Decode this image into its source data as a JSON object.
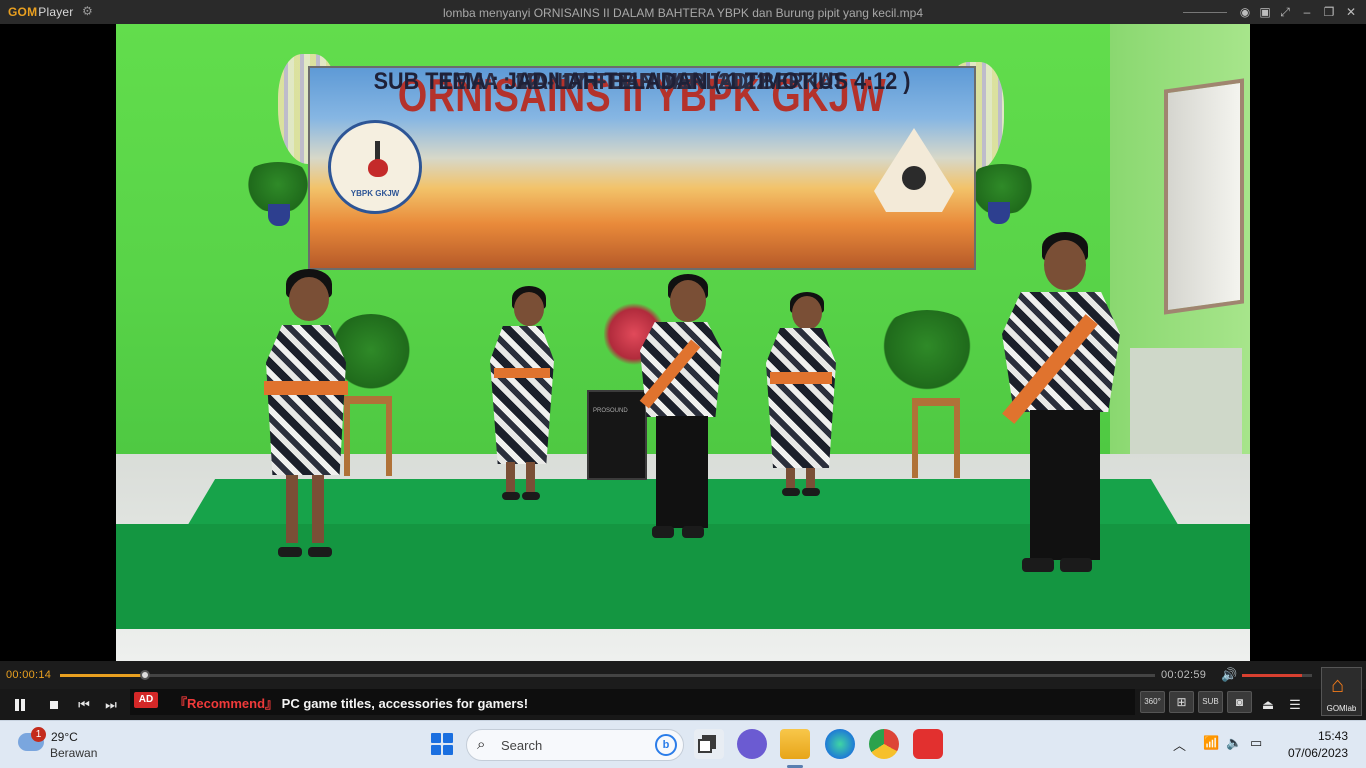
{
  "app": {
    "logo_gom": "GOM",
    "logo_player": "Player",
    "title": "lomba menyanyi ORNISAINS II DALAM BAHTERA YBPK  dan Burung pipit yang kecil.mp4"
  },
  "window_controls": {
    "minimize_icon": "minimize-icon",
    "maximize_icon": "maximize-icon",
    "close_icon": "close-icon"
  },
  "video": {
    "banner_title": "ORNISAINS II YBPK GKJW",
    "banner_date": "12 - 17 FEBRUARI 2022",
    "banner_theme": "TEMA : MANDIRI DAN MENJADI BERKAT",
    "banner_subtheme": "SUB TEMA : JADILAH TELADAN   ( 1 TIMOTIUS 4:12 )",
    "seal_text": "YBPK GKJW",
    "speaker_brand": "PROSOUND"
  },
  "player": {
    "current_time": "00:00:14",
    "total_time": "00:02:59",
    "progress": 0.078,
    "volume": 0.85,
    "ad_badge": "AD",
    "ad_recommend": "『Recommend』",
    "ad_text": "PC game titles, accessories for gamers!",
    "btn_360": "360°",
    "btn_sub": "SUB",
    "gomlab_label": "GOMlab"
  },
  "taskbar": {
    "notification_count": "1",
    "temperature": "29°C",
    "weather": "Berawan",
    "search_placeholder": "Search",
    "bing_label": "b",
    "time": "15:43",
    "date": "07/06/2023"
  },
  "colors": {
    "accent": "#e9a020",
    "ad_red": "#d42828",
    "windows_blue": "#1a6fe0"
  }
}
